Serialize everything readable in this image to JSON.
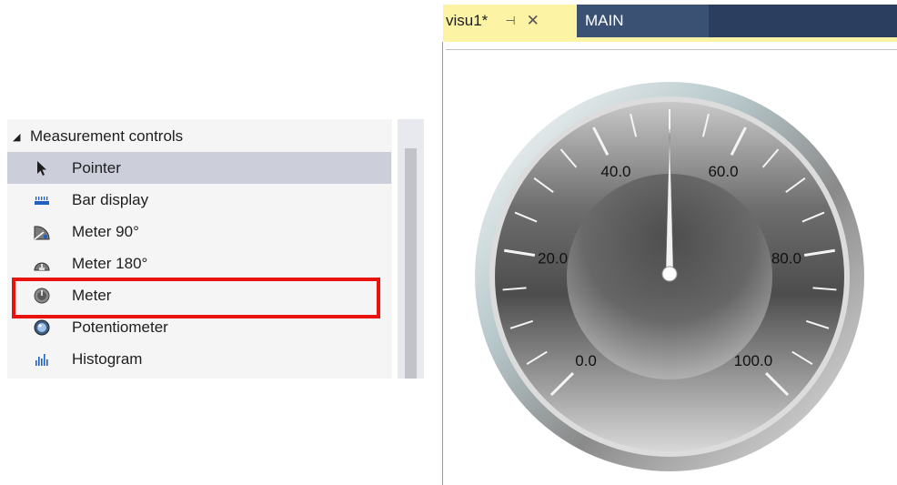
{
  "toolbox": {
    "category": "Measurement controls",
    "items": [
      {
        "label": "Pointer",
        "icon": "pointer-icon",
        "selected": true
      },
      {
        "label": "Bar display",
        "icon": "bar-display-icon"
      },
      {
        "label": "Meter 90°",
        "icon": "meter-90-icon"
      },
      {
        "label": "Meter 180°",
        "icon": "meter-180-icon"
      },
      {
        "label": "Meter",
        "icon": "meter-icon",
        "highlighted": true
      },
      {
        "label": "Potentiometer",
        "icon": "potentiometer-icon"
      },
      {
        "label": "Histogram",
        "icon": "histogram-icon"
      }
    ]
  },
  "tabs": [
    {
      "title": "visu1*",
      "pin": "⊣",
      "close": "✕",
      "active": true
    },
    {
      "title": "MAIN"
    }
  ],
  "gauge": {
    "labels": [
      "0.0",
      "20.0",
      "40.0",
      "60.0",
      "80.0",
      "100.0"
    ],
    "min": 0,
    "max": 100,
    "value": 50
  },
  "colors": {
    "highlight": "#e8130f",
    "tab_active": "#fcf3a4",
    "tabbar": "#2c3e5f",
    "selected_item": "#ccced9"
  }
}
